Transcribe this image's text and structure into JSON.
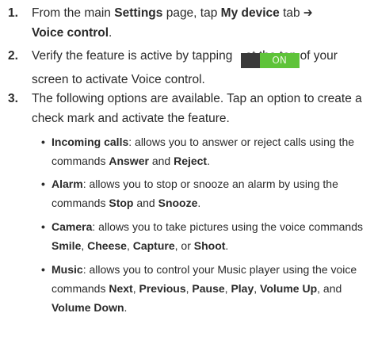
{
  "steps": [
    {
      "num": "1.",
      "t1": "From the main ",
      "b1": "Settings",
      "t2": " page, tap ",
      "b2": "My device",
      "t3": " tab ➔ ",
      "b3": "Voice control",
      "t4": "."
    },
    {
      "num": "2.",
      "t1": "Verify the feature is active by tapping ",
      "toggle_label": "ON",
      "t2": " at the top of your screen to activate Voice control."
    },
    {
      "num": "3.",
      "t1": "The following options are available. Tap an option to create a check mark and activate the feature."
    }
  ],
  "bullets": [
    {
      "dot": "•",
      "title": "Incoming calls",
      "t1": ": allows you to answer or reject calls using the commands ",
      "b1": "Answer",
      "t2": " and ",
      "b2": "Reject",
      "t3": "."
    },
    {
      "dot": "•",
      "title": "Alarm",
      "t1": ": allows you to stop or snooze an alarm by using the commands ",
      "b1": "Stop",
      "t2": " and ",
      "b2": "Snooze",
      "t3": "."
    },
    {
      "dot": "•",
      "title": "Camera",
      "t1": ": allows you to take pictures using the voice commands ",
      "b1": "Smile",
      "t2": ", ",
      "b2": "Cheese",
      "t3": ", ",
      "b3": "Capture",
      "t4": ", or ",
      "b4": "Shoot",
      "t5": "."
    },
    {
      "dot": "•",
      "title": "Music",
      "t1": ": allows you to control your Music player using the voice commands ",
      "b1": "Next",
      "t2": ", ",
      "b2": "Previous",
      "t3": ", ",
      "b3": "Pause",
      "t4": ", ",
      "b4": "Play",
      "t5": ", ",
      "b5": "Volume Up",
      "t6": ", and ",
      "b6": "Volume Down",
      "t7": "."
    }
  ],
  "colors": {
    "toggle_on": "#5ec339",
    "toggle_off": "#3a3a3a",
    "text": "#2a2a2a"
  }
}
